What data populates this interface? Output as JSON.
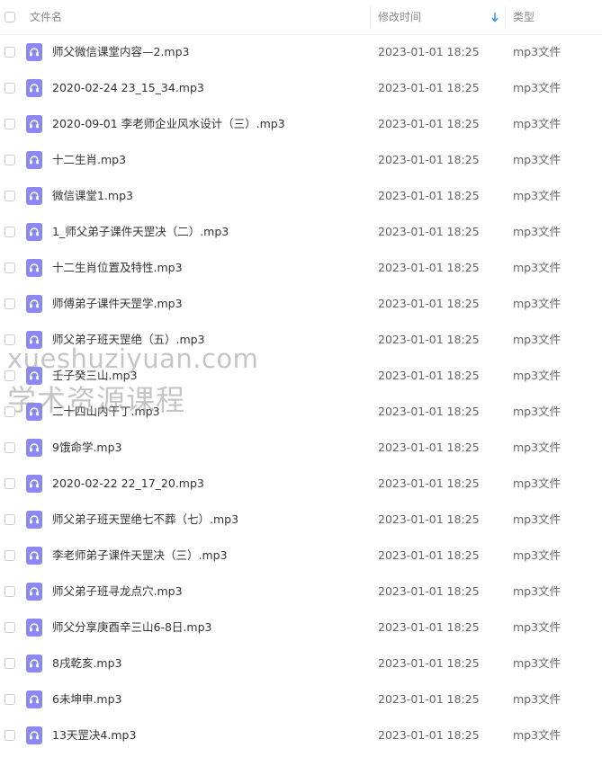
{
  "header": {
    "name_label": "文件名",
    "time_label": "修改时间",
    "type_label": "类型",
    "sort_icon": "sort-down-arrow-icon"
  },
  "files": [
    {
      "name": "师父微信课堂内容—2.mp3",
      "time": "2023-01-01 18:25",
      "type": "mp3文件"
    },
    {
      "name": "2020-02-24 23_15_34.mp3",
      "time": "2023-01-01 18:25",
      "type": "mp3文件"
    },
    {
      "name": "2020-09-01 李老师企业风水设计（三）.mp3",
      "time": "2023-01-01 18:25",
      "type": "mp3文件"
    },
    {
      "name": "十二生肖.mp3",
      "time": "2023-01-01 18:25",
      "type": "mp3文件"
    },
    {
      "name": "微信课堂1.mp3",
      "time": "2023-01-01 18:25",
      "type": "mp3文件"
    },
    {
      "name": "1_师父弟子课件天罡决（二）.mp3",
      "time": "2023-01-01 18:25",
      "type": "mp3文件"
    },
    {
      "name": "十二生肖位置及特性.mp3",
      "time": "2023-01-01 18:25",
      "type": "mp3文件"
    },
    {
      "name": "师傅弟子课件天罡学.mp3",
      "time": "2023-01-01 18:25",
      "type": "mp3文件"
    },
    {
      "name": "师父弟子班天罡绝（五）.mp3",
      "time": "2023-01-01 18:25",
      "type": "mp3文件"
    },
    {
      "name": "壬子癸三山.mp3",
      "time": "2023-01-01 18:25",
      "type": "mp3文件"
    },
    {
      "name": "二十四山内干丁.mp3",
      "time": "2023-01-01 18:25",
      "type": "mp3文件"
    },
    {
      "name": "9饿命学.mp3",
      "time": "2023-01-01 18:25",
      "type": "mp3文件"
    },
    {
      "name": "2020-02-22 22_17_20.mp3",
      "time": "2023-01-01 18:25",
      "type": "mp3文件"
    },
    {
      "name": "师父弟子班天罡绝七不葬（七）.mp3",
      "time": "2023-01-01 18:25",
      "type": "mp3文件"
    },
    {
      "name": "李老师弟子课件天罡决（三）.mp3",
      "time": "2023-01-01 18:25",
      "type": "mp3文件"
    },
    {
      "name": "师父弟子班寻龙点穴.mp3",
      "time": "2023-01-01 18:25",
      "type": "mp3文件"
    },
    {
      "name": "师父分享庚酉辛三山6-8日.mp3",
      "time": "2023-01-01 18:25",
      "type": "mp3文件"
    },
    {
      "name": "8戌乾亥.mp3",
      "time": "2023-01-01 18:25",
      "type": "mp3文件"
    },
    {
      "name": "6未坤申.mp3",
      "time": "2023-01-01 18:25",
      "type": "mp3文件"
    },
    {
      "name": "13天罡决4.mp3",
      "time": "2023-01-01 18:25",
      "type": "mp3文件"
    }
  ],
  "file_icon": "audio-file-icon",
  "accent_color": "#8b88f2",
  "sort_color": "#2f8cf6",
  "watermark": {
    "line1": "xueshuziyuan.com",
    "line2": "学术资源课程"
  }
}
